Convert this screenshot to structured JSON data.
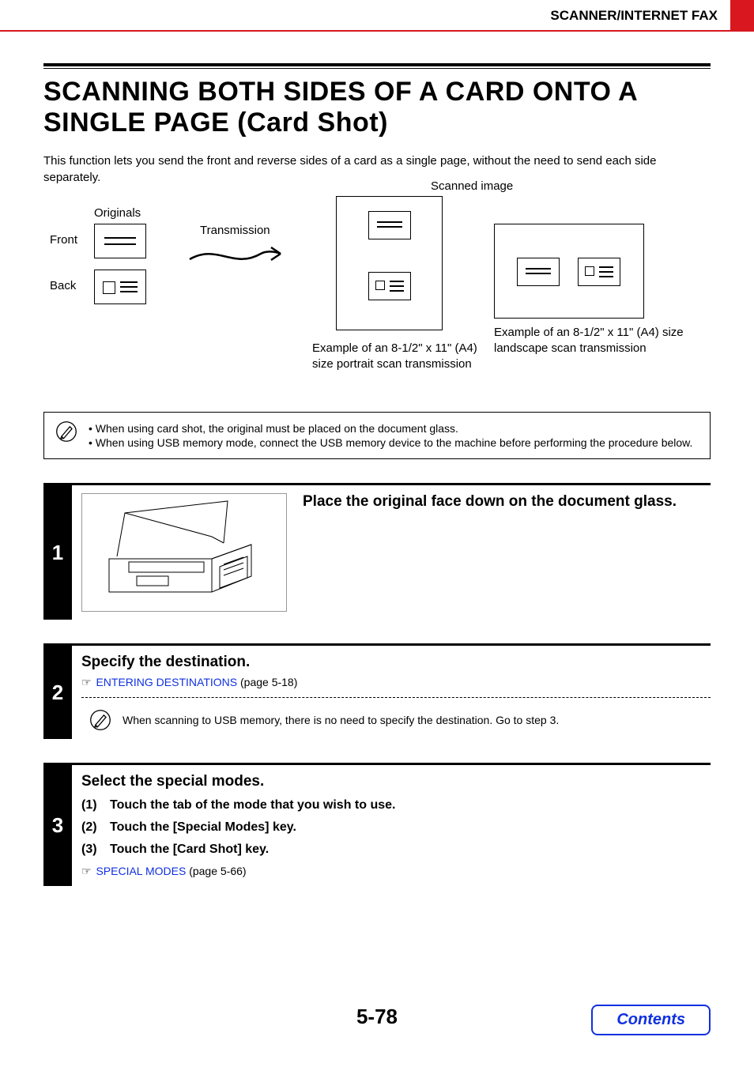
{
  "header": {
    "section": "SCANNER/INTERNET FAX"
  },
  "title": "SCANNING BOTH SIDES OF A CARD ONTO A SINGLE PAGE (Card Shot)",
  "intro": "This function lets you send the front and reverse sides of a card as a single page, without the need to send each side separately.",
  "diagram": {
    "originals_label": "Originals",
    "front_label": "Front",
    "back_label": "Back",
    "transmission_label": "Transmission",
    "scanned_image_label": "Scanned image",
    "caption_portrait": "Example of an 8-1/2\" x 11\" (A4) size portrait scan transmission",
    "caption_landscape": "Example of an 8-1/2\" x 11\" (A4) size landscape scan transmission"
  },
  "note1": {
    "bullet1": "• When using card shot, the original must be placed on the document glass.",
    "bullet2": "• When using USB memory mode, connect the USB memory device to the machine before performing the procedure below."
  },
  "steps": {
    "s1": {
      "num": "1",
      "title": "Place the original face down on the document glass."
    },
    "s2": {
      "num": "2",
      "title": "Specify the destination.",
      "ref_icon": "☞",
      "link_text": "ENTERING DESTINATIONS",
      "link_page": " (page 5-18)",
      "note": "When scanning to USB memory, there is no need to specify the destination. Go to step 3."
    },
    "s3": {
      "num": "3",
      "title": "Select the special modes.",
      "i1_num": "(1)",
      "i1_text": "Touch the tab of the mode that you wish to use.",
      "i2_num": "(2)",
      "i2_text": "Touch the [Special Modes] key.",
      "i3_num": "(3)",
      "i3_text": "Touch the [Card Shot] key.",
      "ref_icon": "☞",
      "link_text": "SPECIAL MODES",
      "link_page": " (page 5-66)"
    }
  },
  "footer": {
    "page_number": "5-78",
    "contents_label": "Contents"
  }
}
